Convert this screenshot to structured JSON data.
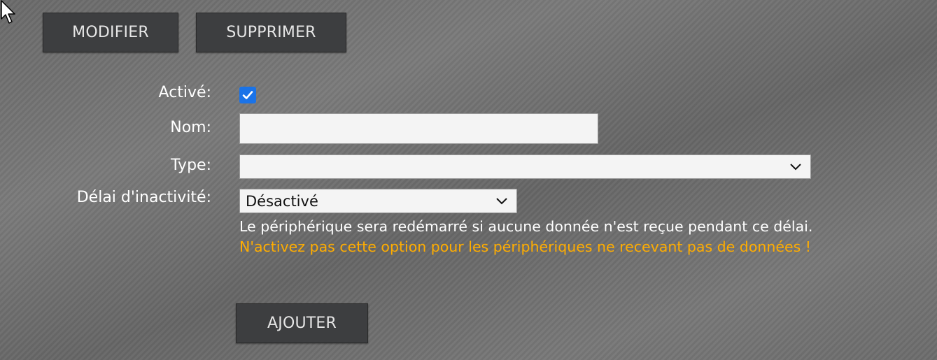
{
  "toolbar": {
    "modify_label": "MODIFIER",
    "delete_label": "SUPPRIMER"
  },
  "form": {
    "active": {
      "label": "Activé:",
      "checked": true
    },
    "name": {
      "label": "Nom:",
      "value": "",
      "placeholder": ""
    },
    "type": {
      "label": "Type:",
      "selected": ""
    },
    "inactivity_delay": {
      "label": "Délai d'inactivité:",
      "selected": "Désactivé",
      "help_text": "Le périphérique sera redémarré si aucune donnée n'est reçue pendant ce délai.",
      "warning_text": "N'activez pas cette option pour les périphériques ne recevant pas de données !"
    },
    "submit_label": "AJOUTER"
  },
  "colors": {
    "button_bg": "#3d3e40",
    "checkbox_accent": "#1a73e8",
    "warning_text": "#ffad00"
  },
  "icons": {
    "cursor": "mouse-pointer-icon",
    "checkmark": "checkmark-icon",
    "dropdown": "chevron-down-icon"
  }
}
